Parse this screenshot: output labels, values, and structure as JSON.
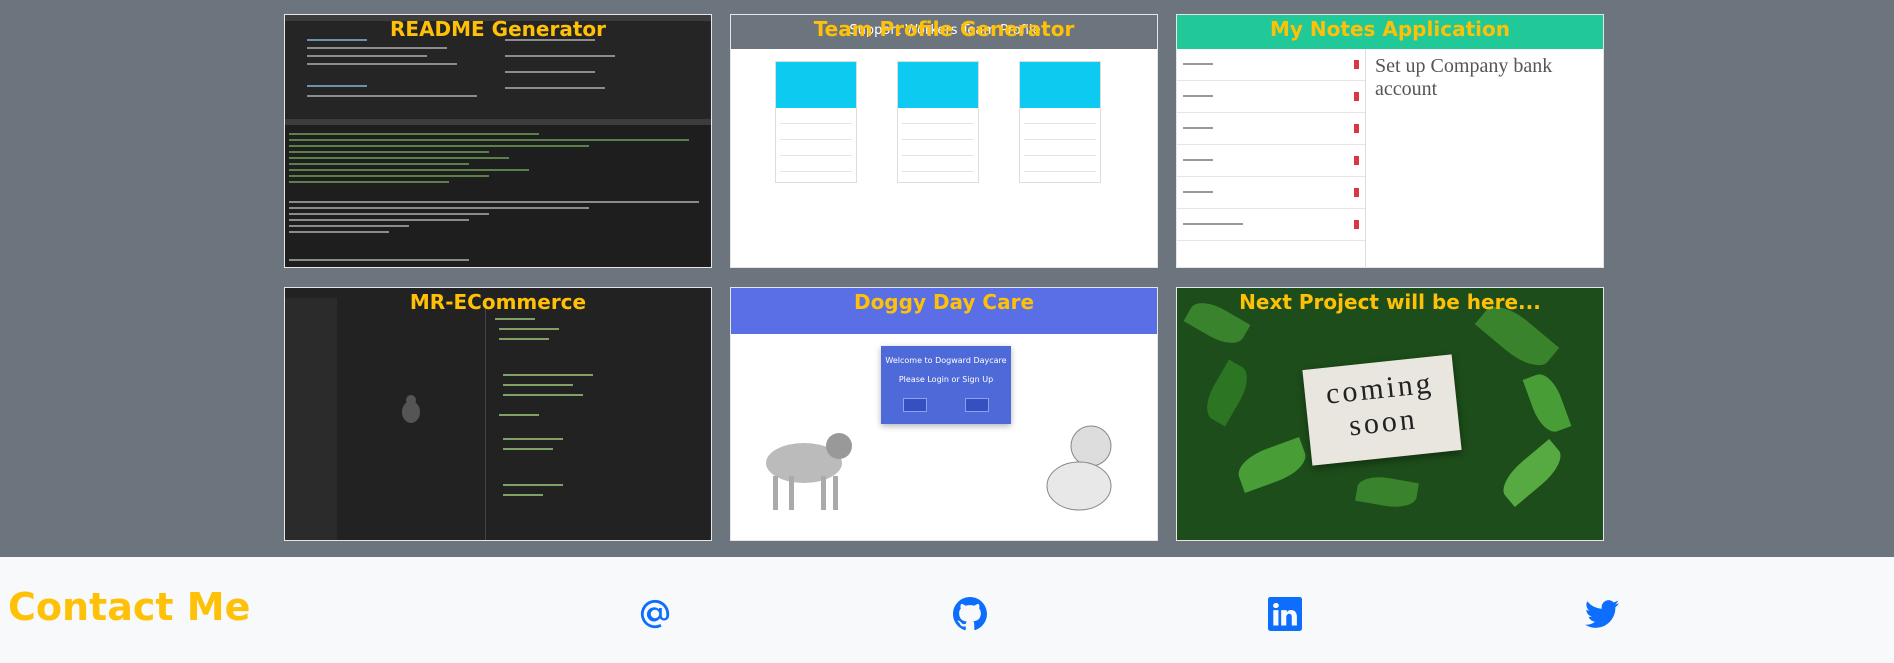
{
  "projects": [
    {
      "title": "README Generator"
    },
    {
      "title": "Team Profile Generator",
      "shot_heading": "Support Workers Team Profile"
    },
    {
      "title": "My Notes Application",
      "shot_heading": "Set up Company bank account"
    },
    {
      "title": "MR-ECommerce"
    },
    {
      "title": "Doggy Day Care",
      "modal_title": "Welcome to Dogward Daycare",
      "modal_sub": "Please Login or Sign Up"
    },
    {
      "title": "Next Project will be here...",
      "sign_line1": "coming",
      "sign_line2": "soon"
    }
  ],
  "footer": {
    "heading": "Contact Me",
    "icons": [
      "email-icon",
      "github-icon",
      "linkedin-icon",
      "twitter-icon"
    ],
    "icon_color": "#0d6efd"
  },
  "colors": {
    "accent": "#ffc107",
    "page_bg": "#6c757d",
    "footer_bg": "#f8f9fa"
  }
}
